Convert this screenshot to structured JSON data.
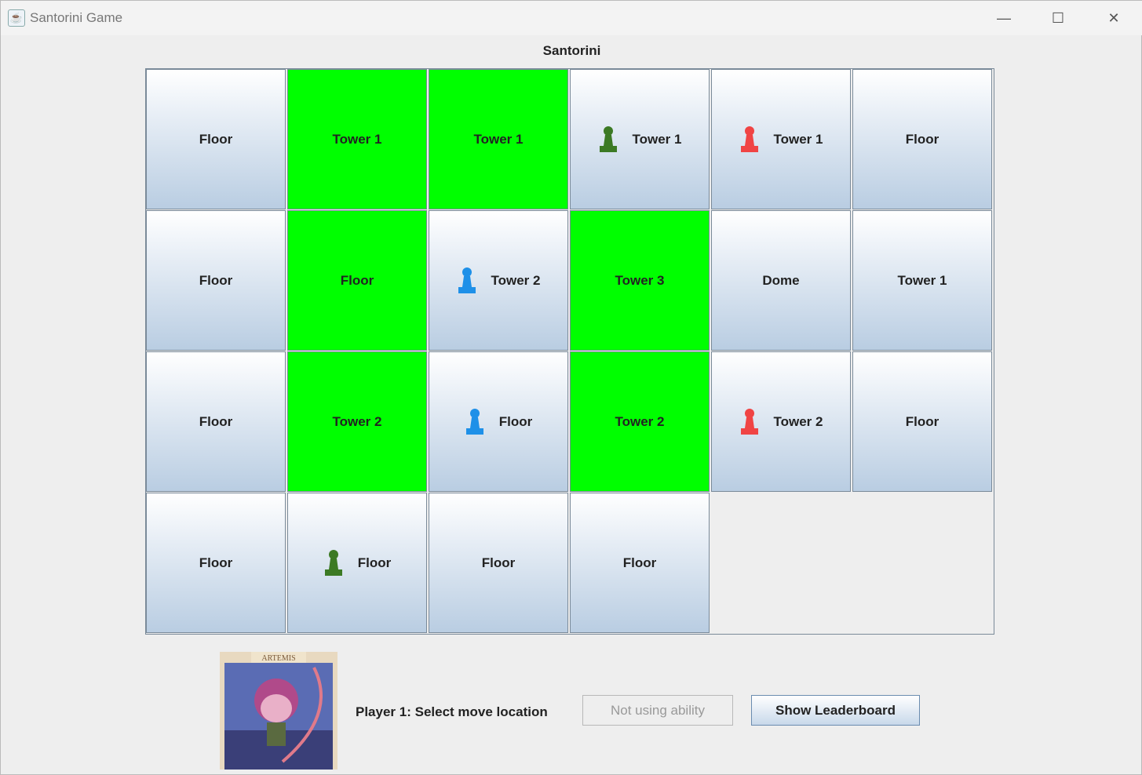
{
  "window": {
    "title": "Santorini Game",
    "controls": [
      "minimize",
      "maximize",
      "close"
    ]
  },
  "heading": "Santorini",
  "colors": {
    "highlight": "#00ff00",
    "green_worker": "#3c7a24",
    "red_worker": "#f04444",
    "blue_worker": "#1e90e8"
  },
  "board": {
    "rows": [
      [
        {
          "label": "Floor",
          "hl": false,
          "piece": null
        },
        {
          "label": "Tower 1",
          "hl": true,
          "piece": null
        },
        {
          "label": "Tower 1",
          "hl": true,
          "piece": null
        },
        {
          "label": "Tower 1",
          "hl": false,
          "piece": "green"
        },
        {
          "label": "Tower 1",
          "hl": false,
          "piece": "red"
        },
        {
          "label": "Floor",
          "hl": false,
          "piece": null
        }
      ],
      [
        {
          "label": "Floor",
          "hl": false,
          "piece": null
        },
        {
          "label": "Floor",
          "hl": true,
          "piece": null
        },
        {
          "label": "Tower 2",
          "hl": false,
          "piece": "blue"
        },
        {
          "label": "Tower 3",
          "hl": true,
          "piece": null
        },
        {
          "label": "Dome",
          "hl": false,
          "piece": null
        },
        {
          "label": "Tower 1",
          "hl": false,
          "piece": null
        }
      ],
      [
        {
          "label": "Floor",
          "hl": false,
          "piece": null
        },
        {
          "label": "Tower 2",
          "hl": true,
          "piece": null
        },
        {
          "label": "Floor",
          "hl": false,
          "piece": "blue"
        },
        {
          "label": "Tower 2",
          "hl": true,
          "piece": null
        },
        {
          "label": "Tower 2",
          "hl": false,
          "piece": "red"
        },
        {
          "label": "Floor",
          "hl": false,
          "piece": null
        }
      ],
      [
        {
          "label": "Floor",
          "hl": false,
          "piece": null
        },
        {
          "label": "Floor",
          "hl": false,
          "piece": "green"
        },
        {
          "label": "Floor",
          "hl": false,
          "piece": null
        },
        {
          "label": "Floor",
          "hl": false,
          "piece": null
        }
      ]
    ]
  },
  "god_card": {
    "name": "ARTEMIS"
  },
  "status": "Player 1: Select move location",
  "buttons": {
    "ability": "Not using ability",
    "leaderboard": "Show Leaderboard"
  }
}
